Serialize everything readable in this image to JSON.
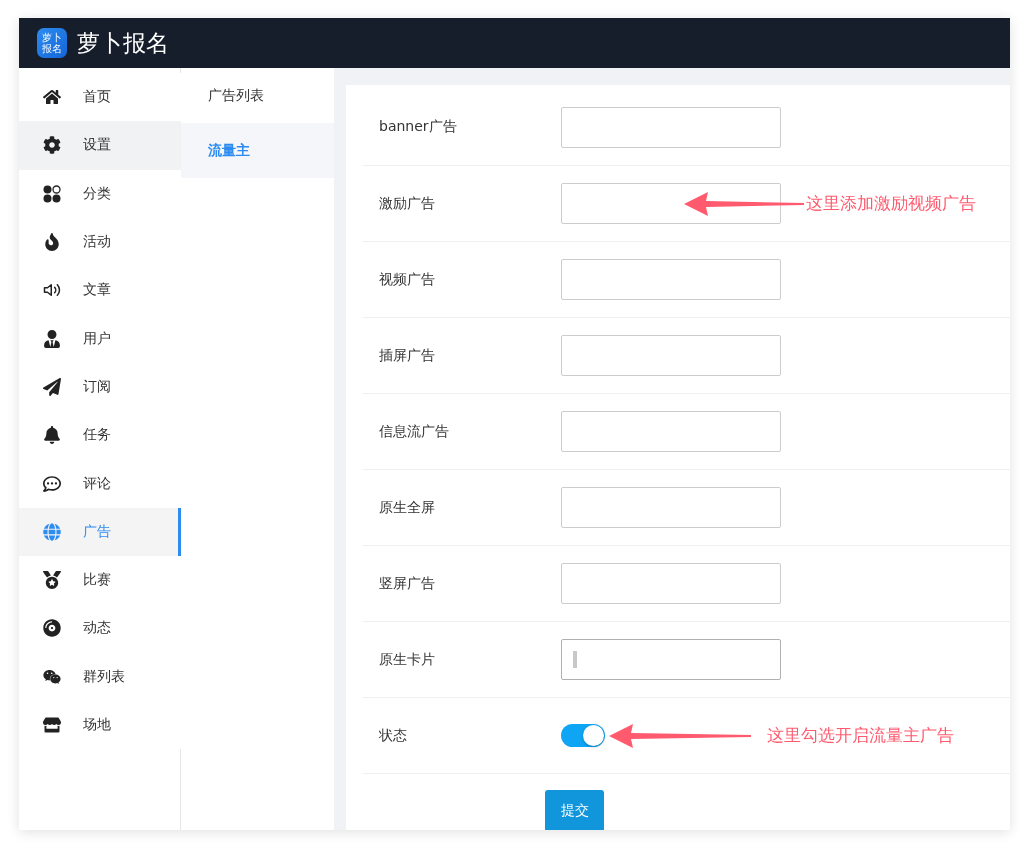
{
  "header": {
    "logo_text": "萝卜报名",
    "title": "萝卜报名"
  },
  "sidebar": {
    "items": [
      {
        "label": "首页",
        "selected": false,
        "hovered": false
      },
      {
        "label": "设置",
        "selected": false,
        "hovered": true
      },
      {
        "label": "分类",
        "selected": false,
        "hovered": false
      },
      {
        "label": "活动",
        "selected": false,
        "hovered": false
      },
      {
        "label": "文章",
        "selected": false,
        "hovered": false
      },
      {
        "label": "用户",
        "selected": false,
        "hovered": false
      },
      {
        "label": "订阅",
        "selected": false,
        "hovered": false
      },
      {
        "label": "任务",
        "selected": false,
        "hovered": false
      },
      {
        "label": "评论",
        "selected": false,
        "hovered": false
      },
      {
        "label": "广告",
        "selected": true,
        "hovered": false
      },
      {
        "label": "比赛",
        "selected": false,
        "hovered": false
      },
      {
        "label": "动态",
        "selected": false,
        "hovered": false
      },
      {
        "label": "群列表",
        "selected": false,
        "hovered": false
      },
      {
        "label": "场地",
        "selected": false,
        "hovered": false
      }
    ]
  },
  "subnav": {
    "items": [
      {
        "label": "广告列表",
        "selected": false
      },
      {
        "label": "流量主",
        "selected": true
      }
    ]
  },
  "form": {
    "fields": [
      {
        "kind": "text",
        "label": "banner广告",
        "focused": false
      },
      {
        "kind": "text",
        "label": "激励广告",
        "focused": false,
        "annotation": "这里添加激励视频广告"
      },
      {
        "kind": "text",
        "label": "视频广告",
        "focused": false
      },
      {
        "kind": "text",
        "label": "插屏广告",
        "focused": false
      },
      {
        "kind": "text",
        "label": "信息流广告",
        "focused": false
      },
      {
        "kind": "text",
        "label": "原生全屏",
        "focused": false
      },
      {
        "kind": "text",
        "label": "竖屏广告",
        "focused": false
      },
      {
        "kind": "text",
        "label": "原生卡片",
        "focused": true
      },
      {
        "kind": "switch",
        "label": "状态",
        "on": true,
        "annotation": "这里勾选开启流量主广告"
      }
    ],
    "submit": "提交"
  }
}
